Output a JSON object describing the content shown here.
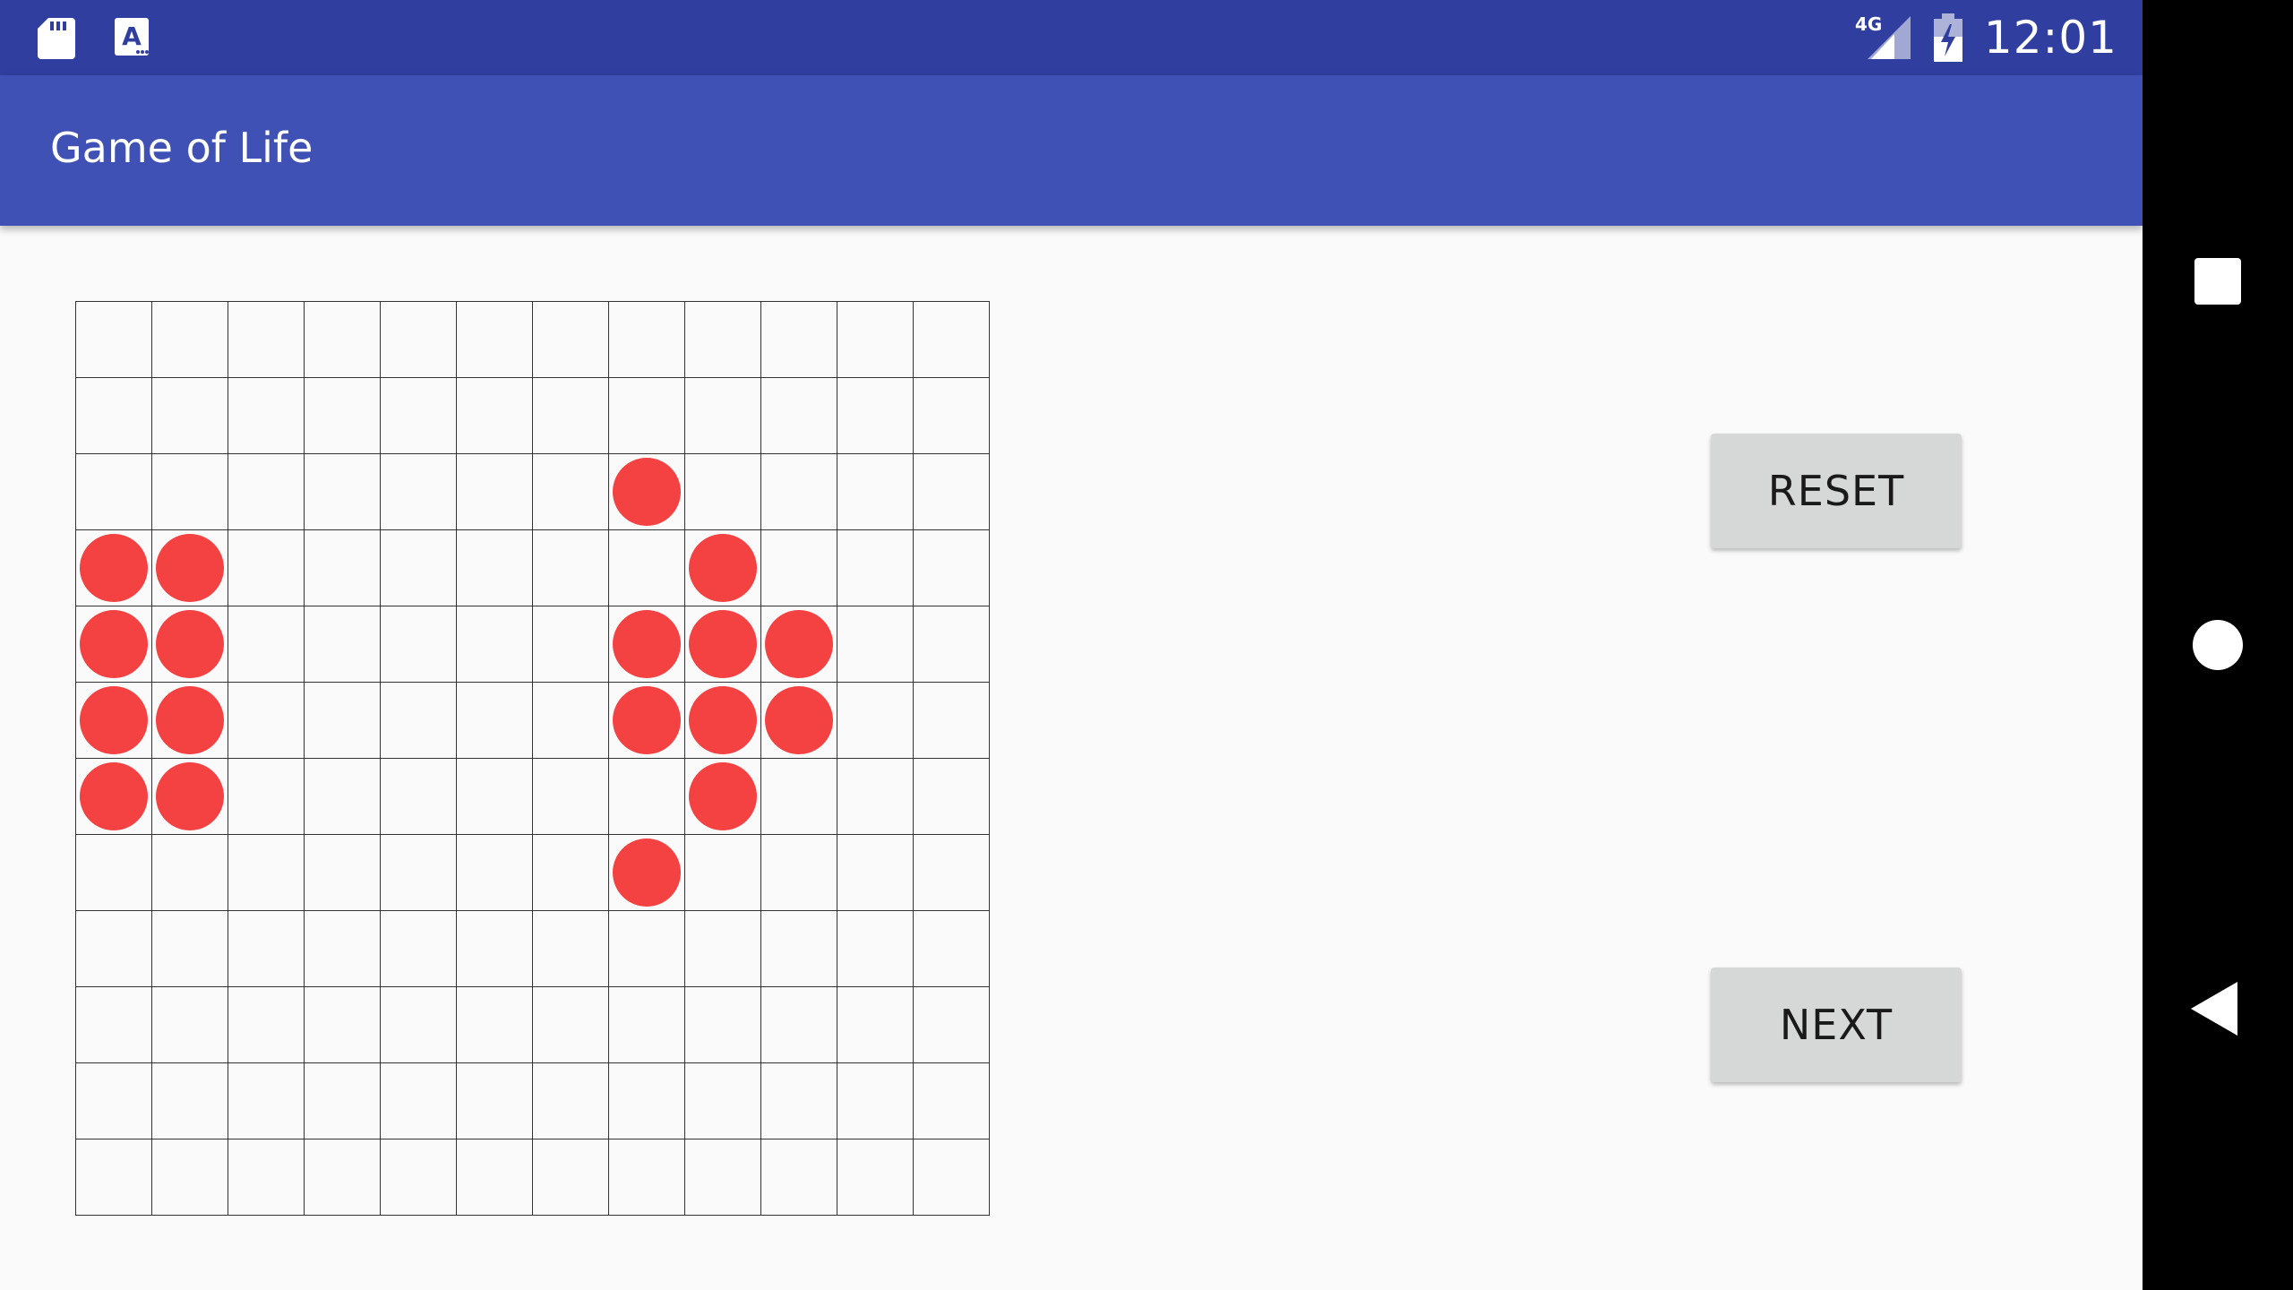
{
  "status_bar": {
    "sd_icon": "sd-card-icon",
    "app_icon": "text-a-icon",
    "network_label": "4G",
    "signal_icon": "signal-icon",
    "battery_icon": "battery-charging-icon",
    "time": "12:01"
  },
  "app_bar": {
    "title": "Game of Life"
  },
  "board": {
    "rows": 12,
    "cols": 12,
    "alive_color": "#f44242",
    "alive_cells": [
      [
        2,
        7
      ],
      [
        3,
        0
      ],
      [
        3,
        1
      ],
      [
        3,
        8
      ],
      [
        4,
        0
      ],
      [
        4,
        1
      ],
      [
        4,
        7
      ],
      [
        4,
        8
      ],
      [
        4,
        9
      ],
      [
        5,
        0
      ],
      [
        5,
        1
      ],
      [
        5,
        7
      ],
      [
        5,
        8
      ],
      [
        5,
        9
      ],
      [
        6,
        0
      ],
      [
        6,
        1
      ],
      [
        6,
        8
      ],
      [
        7,
        7
      ]
    ]
  },
  "buttons": {
    "reset_label": "RESET",
    "next_label": "NEXT"
  },
  "nav_bar": {
    "recents_icon": "square-icon",
    "home_icon": "circle-icon",
    "back_icon": "triangle-back-icon"
  },
  "colors": {
    "status_bar": "#303f9f",
    "app_bar": "#3f51b5",
    "button_bg": "#d6d7d7"
  }
}
